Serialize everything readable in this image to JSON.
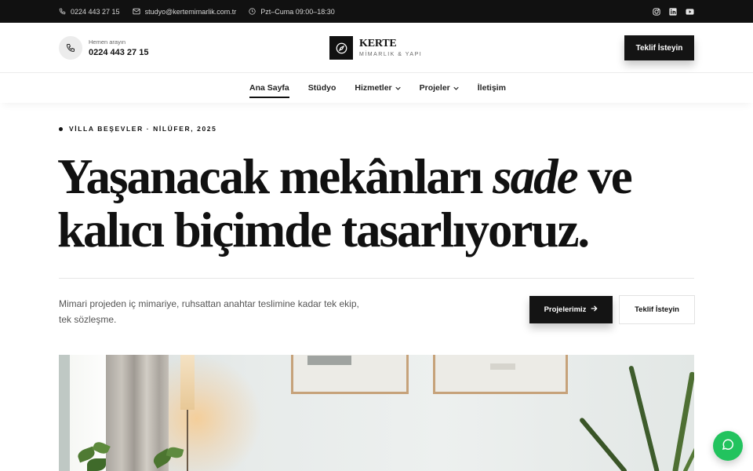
{
  "topbar": {
    "phone": "0224 443 27 15",
    "email": "studyo@kertemimarlik.com.tr",
    "hours": "Pzt–Cuma 09:00–18:30",
    "social": [
      "instagram-icon",
      "linkedin-icon",
      "youtube-icon"
    ]
  },
  "header": {
    "call_label": "Hemen arayın",
    "call_number": "0224 443 27 15",
    "logo_name": "KERTE",
    "logo_sub": "MİMARLIK & YAPI",
    "cta_label": "Teklif İsteyin"
  },
  "nav": {
    "items": [
      {
        "label": "Ana Sayfa",
        "active": true,
        "dropdown": false
      },
      {
        "label": "Stüdyo",
        "active": false,
        "dropdown": false
      },
      {
        "label": "Hizmetler",
        "active": false,
        "dropdown": true
      },
      {
        "label": "Projeler",
        "active": false,
        "dropdown": true
      },
      {
        "label": "İletişim",
        "active": false,
        "dropdown": false
      }
    ]
  },
  "hero": {
    "eyebrow": "VİLLA BEŞEVLER · NİLÜFER, 2025",
    "headline_part1": "Yaşanacak mekânları ",
    "headline_em": "sade",
    "headline_part2": " ve",
    "headline_line2": "kalıcı biçimde tasarlıyoruz.",
    "description": "Mimari projeden iç mimariye, ruhsattan anahtar teslimine kadar tek ekip, tek sözleşme.",
    "primary_cta": "Projelerimiz",
    "secondary_cta": "Teklif İsteyin"
  },
  "colors": {
    "dark": "#111111",
    "accent_chat": "#22c35e",
    "text_muted": "#555555"
  }
}
